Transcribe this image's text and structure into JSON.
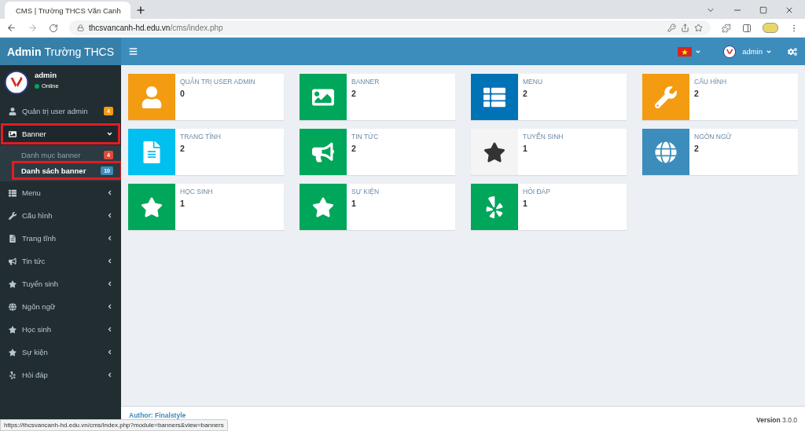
{
  "browser": {
    "tab": {
      "title": "CMS | Trường THCS Văn Canh",
      "selected": true
    },
    "url": {
      "host": "thcsvancanh-hd.edu.vn",
      "path": "/cms/index.php"
    }
  },
  "header": {
    "brand_bold": "Admin",
    "brand_rest": "Trường THCS",
    "user": "admin"
  },
  "sidebar": {
    "user": {
      "name": "admin",
      "status": "Online"
    },
    "items": [
      {
        "label": "Quản trị user admin",
        "selected": false,
        "highlighted": false,
        "badge": {
          "text": "4",
          "color": "#f39c12"
        }
      },
      {
        "label": "Banner",
        "selected": true,
        "highlighted": true,
        "expanded": true,
        "children": [
          {
            "label": "Danh mục banner",
            "selected": false,
            "highlighted": false,
            "badge": {
              "text": "4",
              "color": "#dd4b39"
            }
          },
          {
            "label": "Danh sách banner",
            "selected": true,
            "highlighted": true,
            "badge": {
              "text": "10",
              "color": "#3c8dbc"
            }
          }
        ]
      },
      {
        "label": "Menu",
        "selected": false,
        "highlighted": false,
        "expanded": false
      },
      {
        "label": "Cấu hình",
        "selected": false,
        "highlighted": false,
        "expanded": false
      },
      {
        "label": "Trang tĩnh",
        "selected": false,
        "highlighted": false,
        "expanded": false
      },
      {
        "label": "Tin tức",
        "selected": false,
        "highlighted": false,
        "expanded": false
      },
      {
        "label": "Tuyển sinh",
        "selected": false,
        "highlighted": false,
        "expanded": false
      },
      {
        "label": "Ngôn ngữ",
        "selected": false,
        "highlighted": false,
        "expanded": false
      },
      {
        "label": "Học sinh",
        "selected": false,
        "highlighted": false,
        "expanded": false
      },
      {
        "label": "Sự kiện",
        "selected": false,
        "highlighted": false,
        "expanded": false
      },
      {
        "label": "Hỏi đáp",
        "selected": false,
        "highlighted": false,
        "expanded": false
      }
    ]
  },
  "tiles": [
    {
      "label": "QUẢN TRỊ USER ADMIN",
      "count": "0",
      "color": "#f39c12"
    },
    {
      "label": "BANNER",
      "count": "2",
      "color": "#00a65a"
    },
    {
      "label": "MENU",
      "count": "2",
      "color": "#0073b7"
    },
    {
      "label": "CẤU HÌNH",
      "count": "2",
      "color": "#f39c12"
    },
    {
      "label": "TRANG TĨNH",
      "count": "2",
      "color": "#00c0ef"
    },
    {
      "label": "TIN TỨC",
      "count": "2",
      "color": "#00a65a"
    },
    {
      "label": "TUYỂN SINH",
      "count": "1",
      "color": "#f4f4f4"
    },
    {
      "label": "NGÔN NGỮ",
      "count": "2",
      "color": "#3c8dbc"
    },
    {
      "label": "HỌC SINH",
      "count": "1",
      "color": "#00a65a"
    },
    {
      "label": "SỰ KIỆN",
      "count": "1",
      "color": "#00a65a"
    },
    {
      "label": "HỎI ĐÁP",
      "count": "1",
      "color": "#00a65a"
    }
  ],
  "footer": {
    "author": "Author: Finalstyle",
    "version_label": "Version",
    "version": "3.0.0"
  },
  "status_url": "https://thcsvancanh-hd.edu.vn/cms/index.php?module=banners&view=banners"
}
